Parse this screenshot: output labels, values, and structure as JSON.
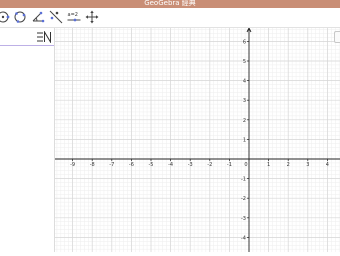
{
  "app": {
    "title": "GeoGebra 經典"
  },
  "toolbar": {
    "tools": [
      {
        "icon": "point-on-circle-icon"
      },
      {
        "icon": "circle-through-points-icon"
      },
      {
        "icon": "angle-icon"
      },
      {
        "icon": "reflect-about-line-icon"
      },
      {
        "icon": "slider-icon",
        "label": "a=2"
      },
      {
        "icon": "move-graphics-view-icon"
      }
    ]
  },
  "algebra_view": {
    "menu_icon": "algebra-menu-icon"
  },
  "graphics_view": {
    "x_ticks": [
      "-9",
      "-8",
      "-7",
      "-6",
      "-5",
      "-4",
      "-3",
      "-2",
      "-1",
      "0",
      "1",
      "2",
      "3",
      "4"
    ],
    "y_ticks": [
      "6",
      "5",
      "4",
      "3",
      "2",
      "1",
      "-1",
      "-2",
      "-3",
      "-4"
    ],
    "grid": true,
    "axes": true
  }
}
